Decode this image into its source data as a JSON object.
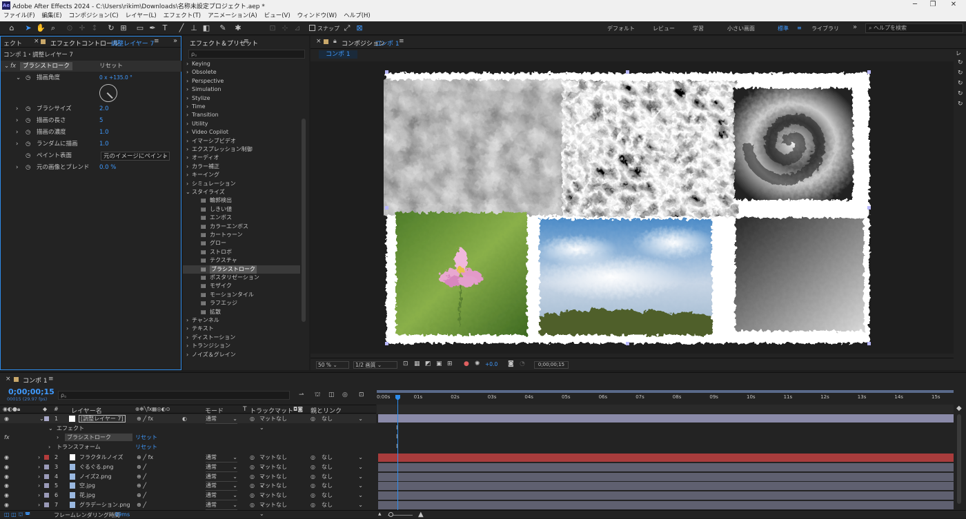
{
  "app": {
    "title": "Adobe After Effects 2024 - C:\\Users\\rikim\\Downloads\\名称未設定プロジェクト.aep *",
    "icon_text": "Ae"
  },
  "menu": [
    "ファイル(F)",
    "編集(E)",
    "コンポジション(C)",
    "レイヤー(L)",
    "エフェクト(T)",
    "アニメーション(A)",
    "ビュー(V)",
    "ウィンドウ(W)",
    "ヘルプ(H)"
  ],
  "toolbar": {
    "snap_label": "スナップ",
    "workspaces": [
      "デフォルト",
      "レビュー",
      "学習",
      "小さい画面",
      "標準",
      "ライブラリ"
    ],
    "active_workspace": "標準",
    "help_placeholder": "ヘルプを検索"
  },
  "effect_controls": {
    "tab_prefix": "エフェクトコントロール",
    "tab_layer": "調整レイヤー 7",
    "left_stub": "ェクト",
    "breadcrumb": "コンポ 1・調整レイヤー 7",
    "effect_name": "ブラシストローク",
    "reset": "リセット",
    "props": [
      {
        "label": "描画角度",
        "value": "0 x +135.0 °"
      },
      {
        "label": "ブラシサイズ",
        "value": "2.0"
      },
      {
        "label": "描画の長さ",
        "value": "5"
      },
      {
        "label": "描画の濃度",
        "value": "1.0"
      },
      {
        "label": "ランダムに描画",
        "value": "1.0"
      },
      {
        "label": "ペイント表面",
        "value": "元のイメージにペイント"
      },
      {
        "label": "元の画像とブレンド",
        "value": "0.0 %"
      }
    ]
  },
  "effects_presets": {
    "title": "エフェクト＆プリセット",
    "search_placeholder": "ρ。",
    "categories_top": [
      "Keying",
      "Obsolete",
      "Perspective",
      "Simulation",
      "Stylize",
      "Time",
      "Transition",
      "Utility",
      "Video Copilot",
      "イマーシブビデオ",
      "エクスプレッション制御",
      "オーディオ",
      "カラー補正",
      "キーイング",
      "シミュレーション"
    ],
    "open_category": "スタイライズ",
    "stylize_items": [
      "輪郭検出",
      "しきい値",
      "エンボス",
      "カラーエンボス",
      "カートゥーン",
      "グロー",
      "ストロボ",
      "テクスチャ",
      "ブラシストローク",
      "ポスタリゼーション",
      "モザイク",
      "モーションタイル",
      "ラフエッジ",
      "拡散"
    ],
    "selected_item": "ブラシストローク",
    "categories_bottom": [
      "チャンネル",
      "テキスト",
      "ディストーション",
      "トランジション",
      "ノイズ＆グレイン"
    ]
  },
  "composition": {
    "tab_prefix": "コンポジション",
    "tab_name": "コンポ 1",
    "sub_tab": "コンポ 1",
    "zoom": "50 %",
    "resolution": "1/2 画質",
    "exposure": "+0.0",
    "timecode": "0;00;00;15"
  },
  "timeline": {
    "tab_name": "コンポ 1",
    "timecode": "0;00;00;15",
    "fps_info": "00015 (29.97 fps)",
    "search_placeholder": "ρ。",
    "columns": {
      "layer_name": "レイヤー名",
      "mode": "モード",
      "t": "T",
      "track_matte": "トラックマット",
      "parent": "親とリンク"
    },
    "ticks": [
      "0:00s",
      "01s",
      "02s",
      "03s",
      "04s",
      "05s",
      "06s",
      "07s",
      "08s",
      "09s",
      "10s",
      "11s",
      "12s",
      "13s",
      "14s",
      "15s"
    ],
    "layer1": {
      "num": "1",
      "name": "[調整レイヤー 7]",
      "mode": "通常",
      "matte": "マットなし",
      "parent": "なし"
    },
    "sub_rows": {
      "effects": "エフェクト",
      "brush": "ブラシストローク",
      "reset": "リセット",
      "transform": "トランスフォーム",
      "reset2": "リセット"
    },
    "layers": [
      {
        "num": "2",
        "name": "フラクタルノイズ",
        "color": "#b33b3b",
        "mode": "通常",
        "matte": "マットなし",
        "parent": "なし"
      },
      {
        "num": "3",
        "name": "ぐるぐる.png",
        "color": "#9a9ab8",
        "mode": "通常",
        "matte": "マットなし",
        "parent": "なし"
      },
      {
        "num": "4",
        "name": "ノイズ2.png",
        "color": "#9a9ab8",
        "mode": "通常",
        "matte": "マットなし",
        "parent": "なし"
      },
      {
        "num": "5",
        "name": "空.jpg",
        "color": "#9a9ab8",
        "mode": "通常",
        "matte": "マットなし",
        "parent": "なし"
      },
      {
        "num": "6",
        "name": "花.jpg",
        "color": "#9a9ab8",
        "mode": "通常",
        "matte": "マットなし",
        "parent": "なし"
      },
      {
        "num": "7",
        "name": "グラデーション.png",
        "color": "#9a9ab8",
        "mode": "通常",
        "matte": "マットなし",
        "parent": "なし"
      }
    ],
    "render_label": "フレームレンダリング時間",
    "render_time": "49ms"
  },
  "colors": {
    "accent": "#2d8ceb",
    "panel": "#232323",
    "layer_bar": "#5f6070",
    "adj_bar": "#8a8aa8",
    "red_bar": "#a83c3c"
  }
}
